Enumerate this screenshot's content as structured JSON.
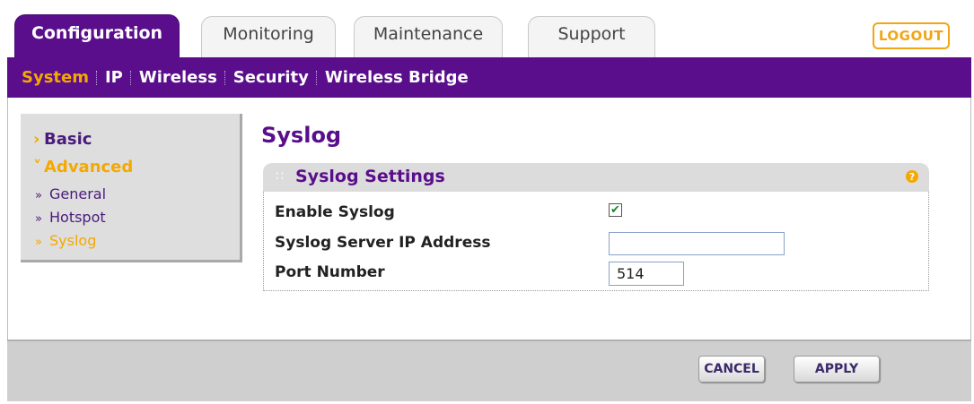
{
  "tabs": [
    {
      "label": "Configuration",
      "active": true
    },
    {
      "label": "Monitoring",
      "active": false
    },
    {
      "label": "Maintenance",
      "active": false
    },
    {
      "label": "Support",
      "active": false
    }
  ],
  "logout_label": "LOGOUT",
  "subnav": [
    {
      "label": "System",
      "active": true
    },
    {
      "label": "IP",
      "active": false
    },
    {
      "label": "Wireless",
      "active": false
    },
    {
      "label": "Security",
      "active": false
    },
    {
      "label": "Wireless Bridge",
      "active": false
    }
  ],
  "sidebar": {
    "basic": "Basic",
    "advanced": "Advanced",
    "items": [
      "General",
      "Hotspot",
      "Syslog"
    ],
    "current": "Syslog"
  },
  "page_title": "Syslog",
  "panel": {
    "title": "Syslog Settings",
    "help_icon": "?",
    "enable_label": "Enable Syslog",
    "enable_checked": true,
    "server_ip_label": "Syslog Server IP Address",
    "server_ip_value": "",
    "port_label": "Port Number",
    "port_value": "514"
  },
  "buttons": {
    "cancel": "CANCEL",
    "apply": "APPLY"
  },
  "colors": {
    "brand_purple": "#5a0e8c",
    "accent_orange": "#f5a800"
  }
}
